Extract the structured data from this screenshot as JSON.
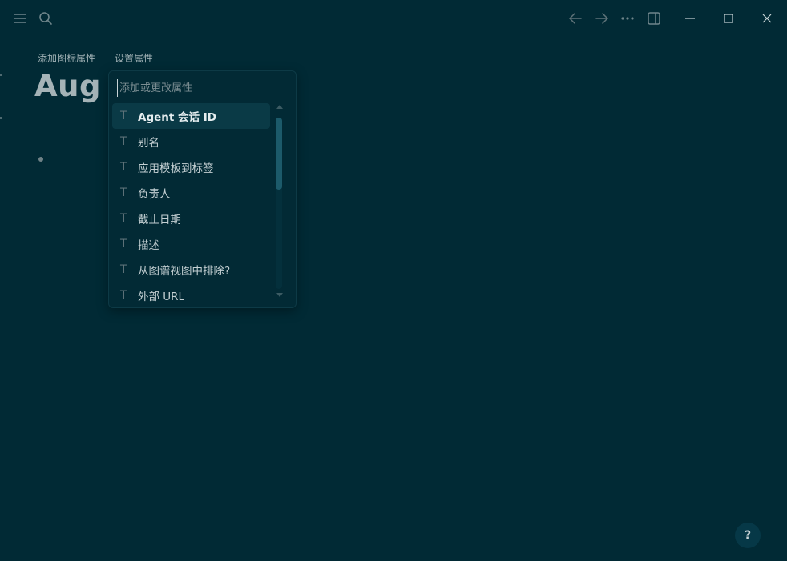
{
  "titlebar": {
    "icons": [
      "menu-icon",
      "search-icon",
      "arrow-left-icon",
      "arrow-right-icon",
      "more-icon",
      "sidebar-toggle-icon",
      "minimize-icon",
      "maximize-icon",
      "close-icon"
    ]
  },
  "meta_actions": {
    "add_icon_property": "添加图标属性",
    "set_property": "设置属性"
  },
  "page": {
    "title": "Aug 7"
  },
  "property_popup": {
    "search_placeholder": "添加或更改属性",
    "type_icon_glyph": "T",
    "items": [
      {
        "label": "Agent 会话 ID",
        "active": true
      },
      {
        "label": "别名"
      },
      {
        "label": "应用模板到标签"
      },
      {
        "label": "负责人"
      },
      {
        "label": "截止日期"
      },
      {
        "label": "描述"
      },
      {
        "label": "从图谱视图中排除?"
      },
      {
        "label": "外部 URL"
      }
    ]
  },
  "help": {
    "label": "?"
  },
  "colors": {
    "background": "#012a35",
    "popup_active": "#0a3a46",
    "scroll_thumb": "#1c5a6a"
  }
}
